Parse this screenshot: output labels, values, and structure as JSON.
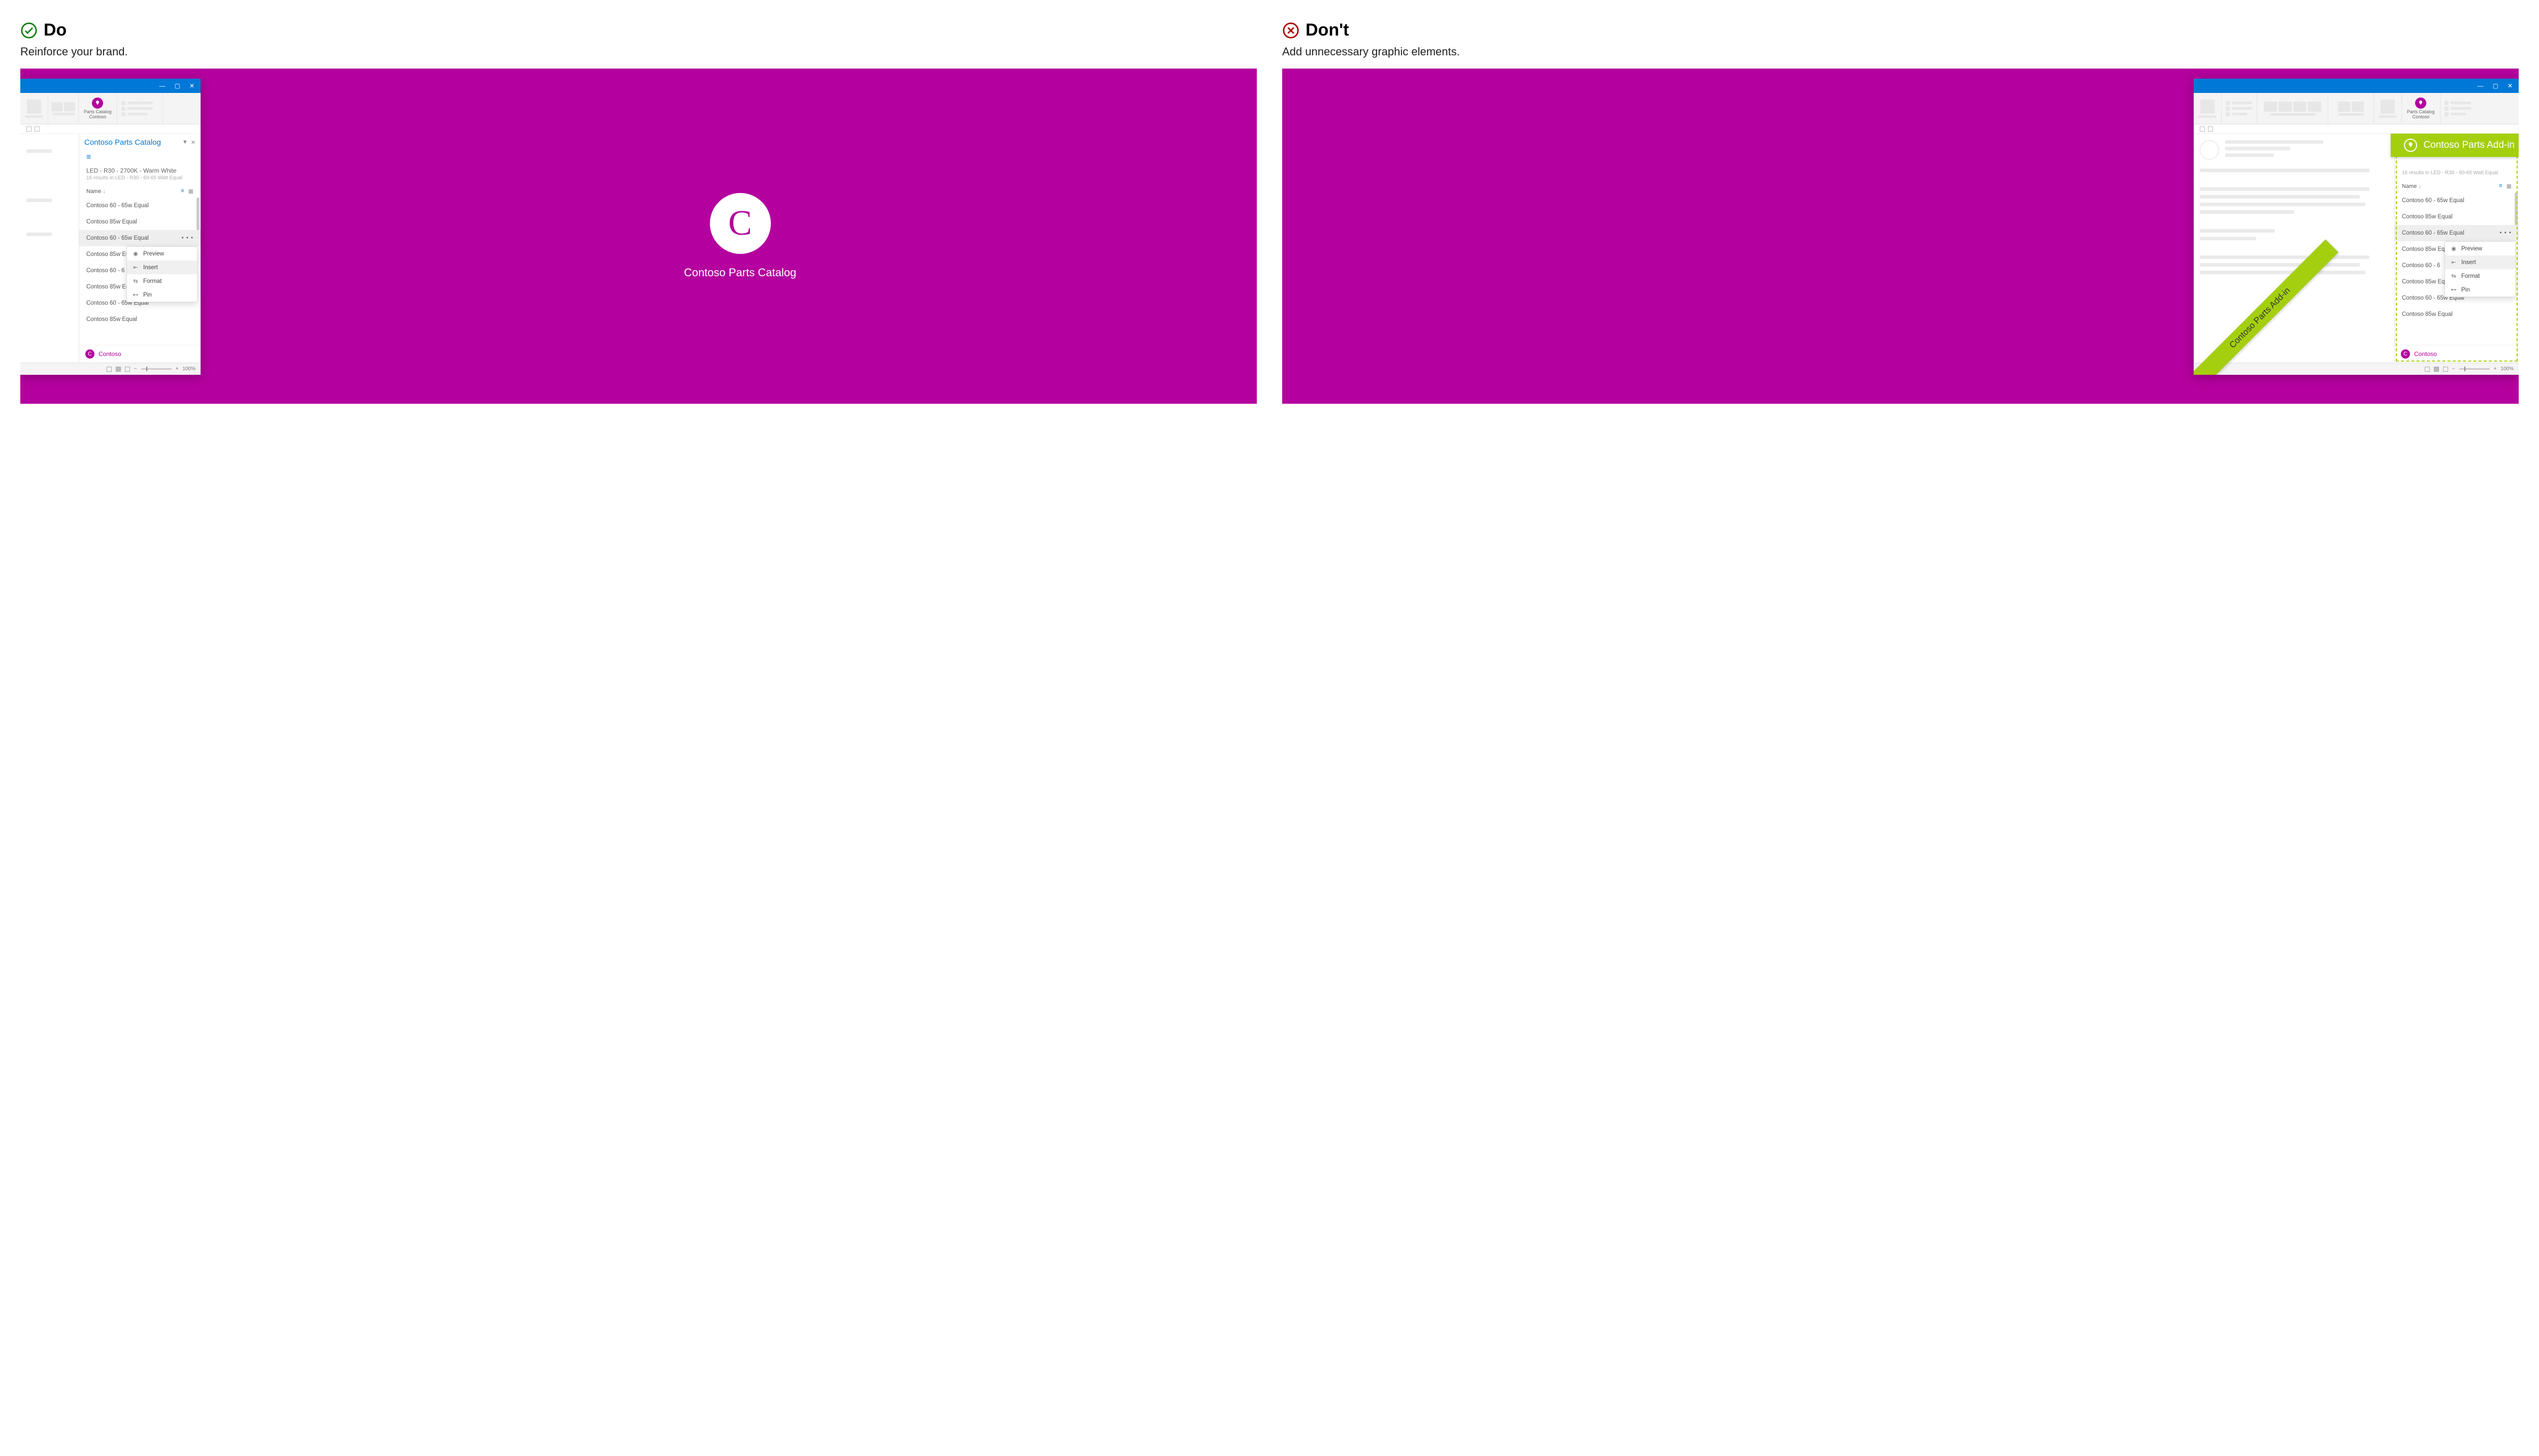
{
  "do": {
    "title": "Do",
    "subtitle": "Reinforce your brand.",
    "splash_label": "Contoso Parts Catalog"
  },
  "dont": {
    "title": "Don't",
    "subtitle": "Add unnecessary graphic elements.",
    "banner": "Contoso Parts Add-in",
    "diag_ribbon": "Contoso Parts Add-in"
  },
  "ribbon_addin": {
    "line1": "Parts Catalog",
    "line2": "Contoso"
  },
  "taskpane": {
    "title": "Contoso Parts Catalog",
    "crumb": "LED - R30 - 2700K - Warm White",
    "sub": "16 results in LED - R30 - 60-65 Watt Equal",
    "col_name": "Name",
    "items": [
      "Contoso 60 - 65w Equal",
      "Contoso 85w Equal",
      "Contoso 60 - 65w Equal",
      "Contoso 85w Equal",
      "Contoso 60 - 65w Equal",
      "Contoso 85w Equal",
      "Contoso 60 - 65w Equal",
      "Contoso 85w Equal"
    ],
    "items_short": [
      "Contoso 60 - 65w Equal",
      "Contoso 85w Equal",
      "Contoso 60 - 65w Equal",
      "Contoso 85w Eq",
      "Contoso 60 - 6",
      "Contoso 85w Eq",
      "Contoso 60 - 65w Equal",
      "Contoso 85w Equal"
    ],
    "footer": "Contoso"
  },
  "context_menu": {
    "preview": "Preview",
    "insert": "Insert",
    "format": "Format",
    "pin": "Pin"
  },
  "statusbar": {
    "zoom": "100%"
  }
}
